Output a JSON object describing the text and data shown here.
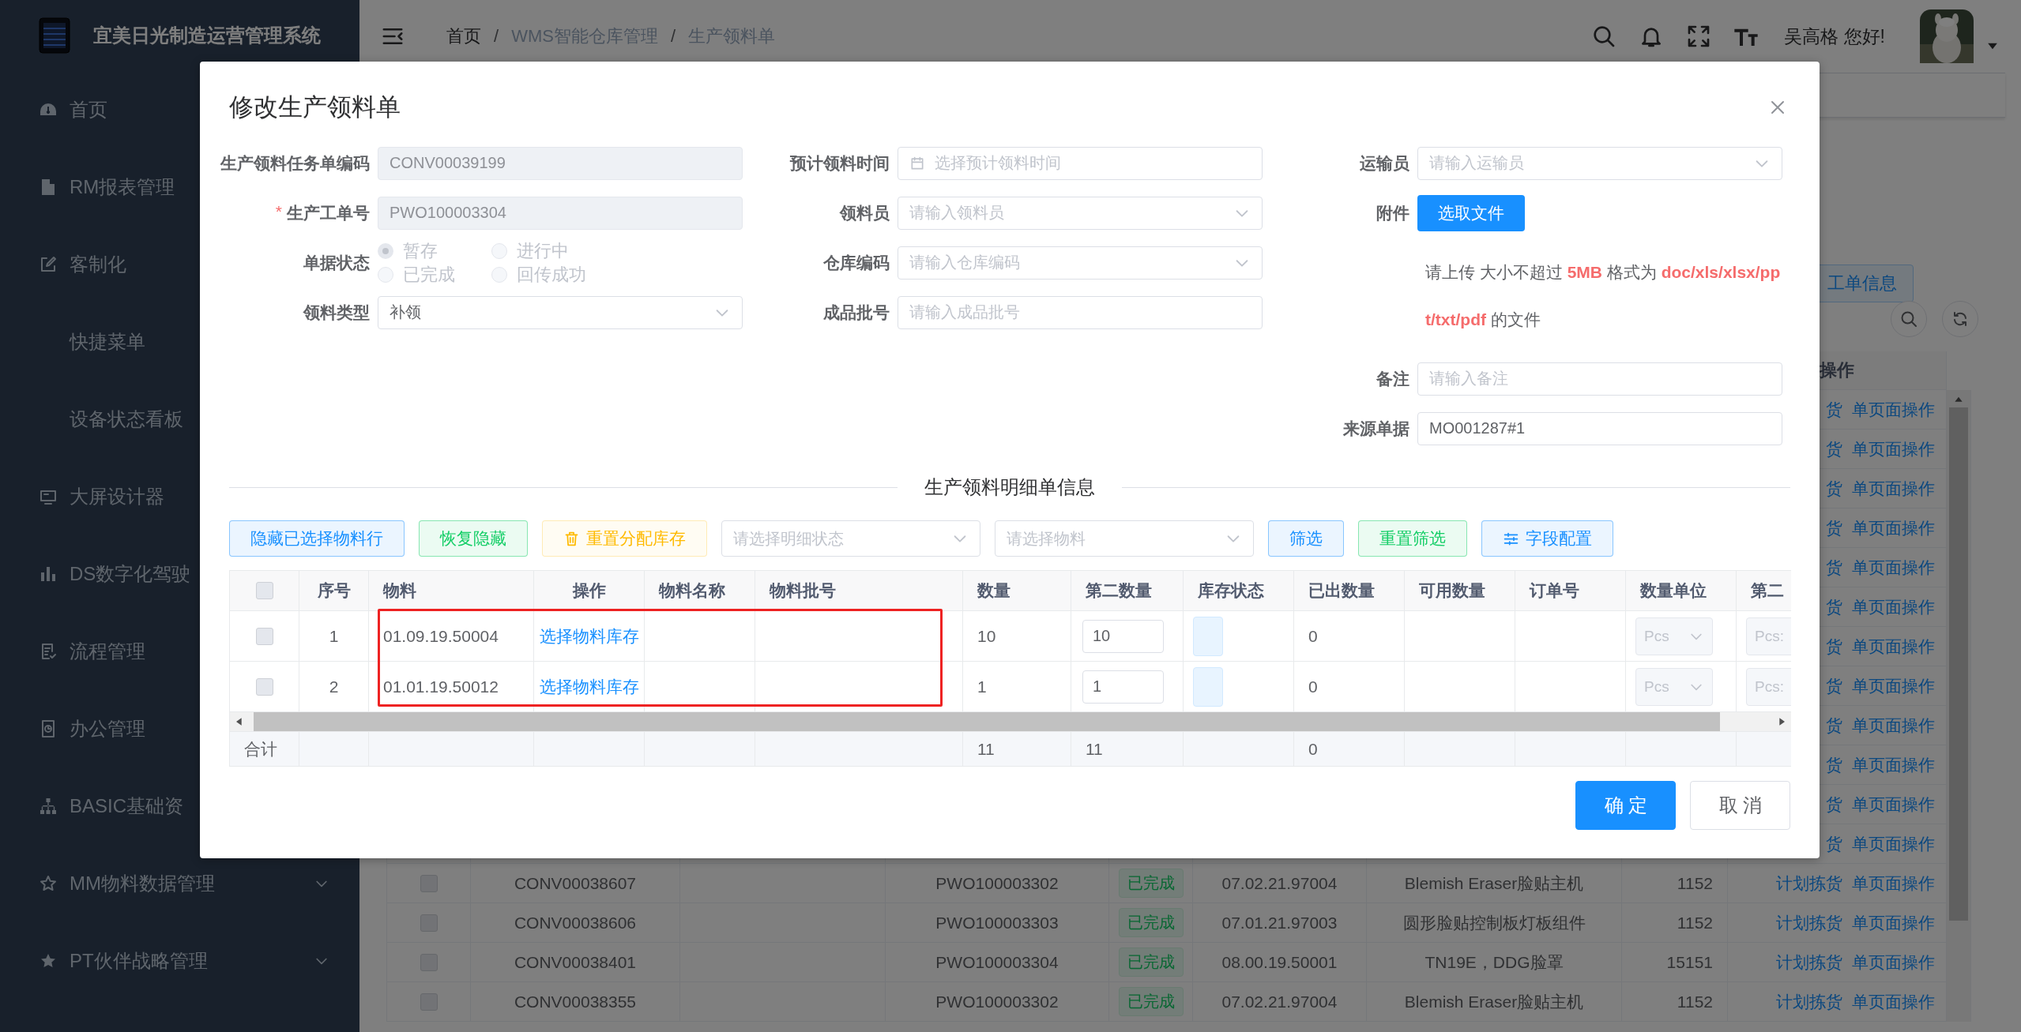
{
  "sidebar": {
    "title": "宜美日光制造运营管理系统",
    "items": [
      {
        "label": "首页"
      },
      {
        "label": "RM报表管理"
      },
      {
        "label": "客制化"
      },
      {
        "label": "快捷菜单"
      },
      {
        "label": "设备状态看板"
      },
      {
        "label": "大屏设计器"
      },
      {
        "label": "DS数字化驾驶"
      },
      {
        "label": "流程管理"
      },
      {
        "label": "办公管理"
      },
      {
        "label": "BASIC基础资"
      },
      {
        "label": "MM物料数据管理",
        "expandable": true
      },
      {
        "label": "PT伙伴战略管理",
        "expandable": true
      }
    ]
  },
  "topbar": {
    "breadcrumb": [
      {
        "kind": "link",
        "text": "首页"
      },
      {
        "kind": "separator",
        "text": "/"
      },
      {
        "kind": "text",
        "text": "WMS智能仓库管理"
      },
      {
        "kind": "separator",
        "text": "/"
      },
      {
        "kind": "text",
        "text": "生产领料单"
      }
    ],
    "greeting": "吴高格 您好!"
  },
  "page": {
    "toolbar_button": "工单信息",
    "table": {
      "action_header": "操作",
      "rows": [
        {
          "kind": "covered",
          "actions": [
            "货",
            "单页面操作"
          ]
        },
        {
          "kind": "covered",
          "actions": [
            "货",
            "单页面操作"
          ]
        },
        {
          "kind": "covered",
          "actions": [
            "货",
            "单页面操作"
          ]
        },
        {
          "kind": "covered",
          "actions": [
            "货",
            "单页面操作"
          ]
        },
        {
          "kind": "covered",
          "actions": [
            "货",
            "单页面操作"
          ]
        },
        {
          "kind": "covered",
          "actions": [
            "货",
            "单页面操作"
          ]
        },
        {
          "kind": "covered",
          "actions": [
            "货",
            "单页面操作"
          ]
        },
        {
          "kind": "covered",
          "actions": [
            "货",
            "单页面操作"
          ]
        },
        {
          "kind": "covered",
          "actions": [
            "货",
            "单页面操作"
          ]
        },
        {
          "kind": "covered",
          "actions": [
            "货",
            "单页面操作"
          ]
        },
        {
          "kind": "covered",
          "actions": [
            "货",
            "单页面操作"
          ]
        },
        {
          "kind": "covered",
          "actions": [
            "货",
            "单页面操作"
          ]
        },
        {
          "kind": "full",
          "checked": false,
          "code": "CONV00038607",
          "order": "PWO100003302",
          "status": "已完成",
          "material": "07.02.21.97004",
          "name": "Blemish Eraser脸贴主机",
          "quantity": "1152",
          "actions": [
            "计划拣货",
            "单页面操作"
          ]
        },
        {
          "kind": "full",
          "checked": false,
          "code": "CONV00038606",
          "order": "PWO100003303",
          "status": "已完成",
          "material": "07.01.21.97003",
          "name": "圆形脸贴控制板灯板组件",
          "quantity": "1152",
          "actions": [
            "计划拣货",
            "单页面操作"
          ]
        },
        {
          "kind": "full",
          "checked": false,
          "code": "CONV00038401",
          "order": "PWO100003304",
          "status": "已完成",
          "material": "08.00.19.50001",
          "name": "TN19E，DDG脸罩",
          "quantity": "15151",
          "actions": [
            "计划拣货",
            "单页面操作"
          ]
        },
        {
          "kind": "full",
          "checked": false,
          "code": "CONV00038355",
          "order": "PWO100003302",
          "status": "已完成",
          "material": "07.02.21.97004",
          "name": "Blemish Eraser脸贴主机",
          "quantity": "1152",
          "actions": [
            "计划拣货",
            "单页面操作"
          ]
        }
      ]
    }
  },
  "dialog": {
    "title": "修改生产领料单",
    "form": {
      "columns": [
        [
          {
            "kind": "input",
            "label": "生产领料任务单编码",
            "value": "CONV00039199",
            "disabled": true
          },
          {
            "kind": "input",
            "label": "生产工单号",
            "required_mark": "*",
            "value": "PWO100003304",
            "disabled": true
          },
          {
            "kind": "radio",
            "label": "单据状态",
            "disabled": true,
            "options": [
              {
                "label": "暂存",
                "selected": true
              },
              {
                "label": "进行中",
                "selected": false
              },
              {
                "label": "已完成",
                "selected": false
              },
              {
                "label": "回传成功",
                "selected": false
              }
            ]
          },
          {
            "kind": "select",
            "label": "领料类型",
            "value": "补领",
            "disabled": false
          }
        ],
        [
          {
            "kind": "date",
            "label": "预计领料时间",
            "placeholder": "选择预计领料时间",
            "disabled": false
          },
          {
            "kind": "select",
            "label": "领料员",
            "placeholder": "请输入领料员",
            "disabled": false
          },
          {
            "kind": "select",
            "label": "仓库编码",
            "placeholder": "请输入仓库编码",
            "disabled": false
          },
          {
            "kind": "input",
            "label": "成品批号",
            "placeholder": "请输入成品批号",
            "disabled": false
          }
        ],
        [
          {
            "kind": "select",
            "label": "运输员",
            "placeholder": "请输入运输员",
            "disabled": false
          },
          {
            "kind": "upload",
            "label": "附件",
            "button": "选取文件"
          },
          {
            "kind": "hint",
            "text": "请上传 大小不超过 **5MB** 格式为 **doc/xls/xlsx/ppt/txt/pdf** 的文件"
          },
          {
            "kind": "input",
            "label": "备注",
            "placeholder": "请输入备注",
            "disabled": false
          },
          {
            "kind": "input",
            "label": "来源单据",
            "value": "MO001287#1",
            "disabled": false
          }
        ]
      ]
    },
    "section_title": "生产领料明细单信息",
    "toolbar": [
      {
        "kind": "button",
        "label": "隐藏已选择物料行",
        "color": "#1890ff",
        "disabled": false
      },
      {
        "kind": "button",
        "label": "恢复隐藏",
        "color": "#13ce66",
        "disabled": false
      },
      {
        "kind": "button",
        "label": "重置分配库存",
        "color": "#ffba00",
        "disabled": true
      },
      {
        "kind": "select",
        "placeholder": "请选择明细状态"
      },
      {
        "kind": "select",
        "placeholder": "请选择物料"
      },
      {
        "kind": "button",
        "label": "筛选",
        "color": "#1890ff",
        "disabled": false
      },
      {
        "kind": "button",
        "label": "重置筛选",
        "color": "#13ce66",
        "disabled": false
      },
      {
        "kind": "button",
        "label": "字段配置",
        "color": "#1890ff",
        "disabled": false
      }
    ],
    "table": {
      "all_checked": false,
      "columns": [
        "序号",
        "物料",
        "操作",
        "物料名称",
        "物料批号",
        "数量",
        "第二数量",
        "库存状态",
        "已出数量",
        "可用数量",
        "订单号",
        "数量单位",
        "第二"
      ],
      "rows": [
        {
          "checked": false,
          "index": "1",
          "material": "01.09.19.50004",
          "action": "选择物料库存",
          "quantity": "10",
          "second_quantity": "10",
          "issued": "0",
          "unit": "Pcs",
          "second_unit": "Pcs:"
        },
        {
          "checked": false,
          "index": "2",
          "material": "01.01.19.50012",
          "action": "选择物料库存",
          "quantity": "1",
          "second_quantity": "1",
          "issued": "0",
          "unit": "Pcs",
          "second_unit": "Pcs:"
        }
      ],
      "summary": {
        "label": "合计",
        "quantity": "11",
        "second_quantity": "11",
        "issued": "0"
      }
    },
    "footer": [
      {
        "kind": "primary",
        "label": "确定"
      },
      {
        "kind": "default",
        "label": "取消"
      }
    ]
  }
}
